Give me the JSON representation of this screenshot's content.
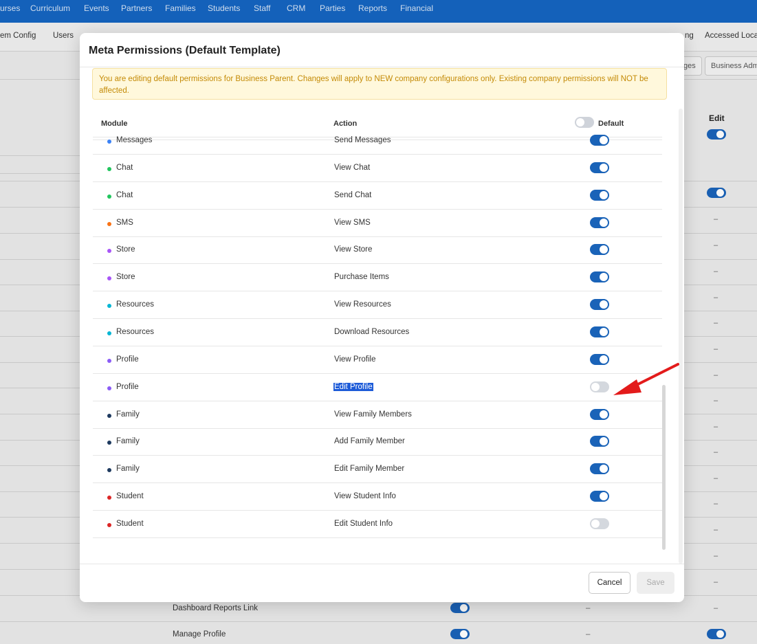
{
  "topnav": {
    "items": [
      "urses",
      "Curriculum",
      "Events",
      "Partners",
      "Families",
      "Students",
      "Staff",
      "CRM",
      "Parties",
      "Reports",
      "Financial"
    ]
  },
  "subnav": {
    "left_items": [
      "em Config",
      "Users"
    ],
    "right_items": [
      "ng",
      "Accessed Loca"
    ]
  },
  "background": {
    "buttons": [
      "ges",
      "Business Adm"
    ],
    "edit_header": "Edit",
    "dash": "–",
    "rows": [
      {
        "label": "Dashboard Reports Link",
        "dash": "–"
      },
      {
        "label": "Manage Profile",
        "dash": "–"
      }
    ]
  },
  "modal": {
    "title": "Meta Permissions (Default Template)",
    "notice": "You are editing default permissions for Business Parent. Changes will apply to NEW company configurations only. Existing company permissions will NOT be affected.",
    "columns": {
      "module": "Module",
      "action": "Action",
      "default": "Default"
    },
    "rows": [
      {
        "module": "Messages",
        "action": "Send Messages",
        "enabled": true,
        "dot": "#3b82f6"
      },
      {
        "module": "Chat",
        "action": "View Chat",
        "enabled": true,
        "dot": "#22c55e"
      },
      {
        "module": "Chat",
        "action": "Send Chat",
        "enabled": true,
        "dot": "#22c55e"
      },
      {
        "module": "SMS",
        "action": "View SMS",
        "enabled": true,
        "dot": "#f97316"
      },
      {
        "module": "Store",
        "action": "View Store",
        "enabled": true,
        "dot": "#a855f7"
      },
      {
        "module": "Store",
        "action": "Purchase Items",
        "enabled": true,
        "dot": "#a855f7"
      },
      {
        "module": "Resources",
        "action": "View Resources",
        "enabled": true,
        "dot": "#06b6d4"
      },
      {
        "module": "Resources",
        "action": "Download Resources",
        "enabled": true,
        "dot": "#06b6d4"
      },
      {
        "module": "Profile",
        "action": "View Profile",
        "enabled": true,
        "dot": "#8b5cf6"
      },
      {
        "module": "Profile",
        "action": "Edit Profile",
        "enabled": false,
        "dot": "#8b5cf6",
        "selected": true
      },
      {
        "module": "Family",
        "action": "View Family Members",
        "enabled": true,
        "dot": "#1e3a5f"
      },
      {
        "module": "Family",
        "action": "Add Family Member",
        "enabled": true,
        "dot": "#1e3a5f"
      },
      {
        "module": "Family",
        "action": "Edit Family Member",
        "enabled": true,
        "dot": "#1e3a5f"
      },
      {
        "module": "Student",
        "action": "View Student Info",
        "enabled": true,
        "dot": "#dc2626"
      },
      {
        "module": "Student",
        "action": "Edit Student Info",
        "enabled": false,
        "dot": "#dc2626"
      }
    ],
    "cancel_label": "Cancel",
    "save_label": "Save"
  },
  "colors": {
    "brand": "#1565c0",
    "toggle_on": "#1a63b8",
    "toggle_off": "#d4d8de",
    "notice_text": "#c48a06",
    "arrow": "#e31b1b"
  },
  "icons": [
    "red-arrow-annotation"
  ]
}
